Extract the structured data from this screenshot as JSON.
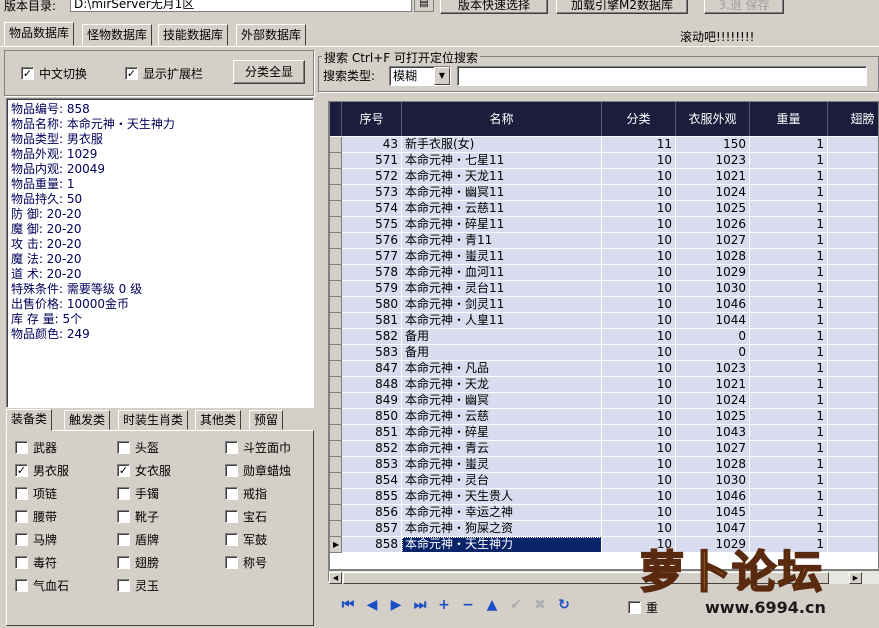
{
  "topbar": {
    "version_label": "版本目录:",
    "path_value": "D:\\mirServer无月1区",
    "path_button_icon": "folder-icon",
    "btn_version": "版本快速选择",
    "btn_load": "加载引擎M2数据库",
    "btn_save": "3.退 保存"
  },
  "tabs": [
    "物品数据库",
    "怪物数据库",
    "技能数据库",
    "外部数据库"
  ],
  "marquee": "滚动吧!!!!!!!!",
  "options": {
    "chinese": "中文切换",
    "ext": "显示扩展栏",
    "show_all": "分类全显"
  },
  "search": {
    "title": "搜索  Ctrl+F 可打开定位搜索",
    "type_label": "搜索类型:",
    "type_value": "模糊",
    "query": ""
  },
  "info": [
    "物品编号: 858",
    "物品名称: 本命元神・天生神力",
    "物品类型: 男衣服",
    "物品外观: 1029",
    "物品内观: 20049",
    "物品重量: 1",
    "物品持久: 50",
    "防    御: 20-20",
    "魔    御: 20-20",
    "攻    击: 20-20",
    "魔    法: 20-20",
    "道    术: 20-20",
    "特殊条件: 需要等级 0 级",
    "出售价格: 10000金币",
    "库 存 量: 5个",
    "物品颜色: 249"
  ],
  "category_tabs": [
    "装备类",
    "触发类",
    "时装生肖类",
    "其他类",
    "预留"
  ],
  "categories": [
    {
      "label": "武器",
      "checked": false
    },
    {
      "label": "头盔",
      "checked": false
    },
    {
      "label": "斗笠面巾",
      "checked": false
    },
    {
      "label": "男衣服",
      "checked": true
    },
    {
      "label": "女衣服",
      "checked": true
    },
    {
      "label": "勋章蜡烛",
      "checked": false
    },
    {
      "label": "项链",
      "checked": false
    },
    {
      "label": "手镯",
      "checked": false
    },
    {
      "label": "戒指",
      "checked": false
    },
    {
      "label": "腰带",
      "checked": false
    },
    {
      "label": "靴子",
      "checked": false
    },
    {
      "label": "宝石",
      "checked": false
    },
    {
      "label": "马牌",
      "checked": false
    },
    {
      "label": "盾牌",
      "checked": false
    },
    {
      "label": "军鼓",
      "checked": false
    },
    {
      "label": "毒符",
      "checked": false
    },
    {
      "label": "翅膀",
      "checked": false
    },
    {
      "label": "称号",
      "checked": false
    },
    {
      "label": "气血石",
      "checked": false
    },
    {
      "label": "灵玉",
      "checked": false
    }
  ],
  "grid": {
    "columns": [
      "序号",
      "名称",
      "分类",
      "衣服外观",
      "重量",
      "翅膀"
    ],
    "rows": [
      [
        "43",
        "新手衣服(女)",
        "11",
        "150",
        "1"
      ],
      [
        "571",
        "本命元神・七星11",
        "10",
        "1023",
        "1"
      ],
      [
        "572",
        "本命元神・天龙11",
        "10",
        "1021",
        "1"
      ],
      [
        "573",
        "本命元神・幽冥11",
        "10",
        "1024",
        "1"
      ],
      [
        "574",
        "本命元神・云慈11",
        "10",
        "1025",
        "1"
      ],
      [
        "575",
        "本命元神・碎星11",
        "10",
        "1026",
        "1"
      ],
      [
        "576",
        "本命元神・青11",
        "10",
        "1027",
        "1"
      ],
      [
        "577",
        "本命元神・蚩灵11",
        "10",
        "1028",
        "1"
      ],
      [
        "578",
        "本命元神・血河11",
        "10",
        "1029",
        "1"
      ],
      [
        "579",
        "本命元神・灵台11",
        "10",
        "1030",
        "1"
      ],
      [
        "580",
        "本命元神・剑灵11",
        "10",
        "1046",
        "1"
      ],
      [
        "581",
        "本命元神・人皇11",
        "10",
        "1044",
        "1"
      ],
      [
        "582",
        "备用",
        "10",
        "0",
        "1"
      ],
      [
        "583",
        "备用",
        "10",
        "0",
        "1"
      ],
      [
        "847",
        "本命元神・凡品",
        "10",
        "1023",
        "1"
      ],
      [
        "848",
        "本命元神・天龙",
        "10",
        "1021",
        "1"
      ],
      [
        "849",
        "本命元神・幽冥",
        "10",
        "1024",
        "1"
      ],
      [
        "850",
        "本命元神・云慈",
        "10",
        "1025",
        "1"
      ],
      [
        "851",
        "本命元神・碎星",
        "10",
        "1043",
        "1"
      ],
      [
        "852",
        "本命元神・青云",
        "10",
        "1027",
        "1"
      ],
      [
        "853",
        "本命元神・蚩灵",
        "10",
        "1028",
        "1"
      ],
      [
        "854",
        "本命元神・灵台",
        "10",
        "1030",
        "1"
      ],
      [
        "855",
        "本命元神・天生贵人",
        "10",
        "1046",
        "1"
      ],
      [
        "856",
        "本命元神・幸运之神",
        "10",
        "1045",
        "1"
      ],
      [
        "857",
        "本命元神・狗屎之资",
        "10",
        "1047",
        "1"
      ],
      [
        "858",
        "本命元神・天生神力",
        "10",
        "1029",
        "1"
      ]
    ],
    "selected_index": 25
  },
  "navigator": [
    "first-icon",
    "prior-icon",
    "next-icon",
    "last-icon",
    "insert-icon",
    "delete-icon",
    "edit-icon",
    "post-icon",
    "cancel-icon",
    "refresh-icon"
  ],
  "bottom_check": "重",
  "watermark": {
    "title": "萝卜论坛",
    "url": "www.6994.cn"
  }
}
